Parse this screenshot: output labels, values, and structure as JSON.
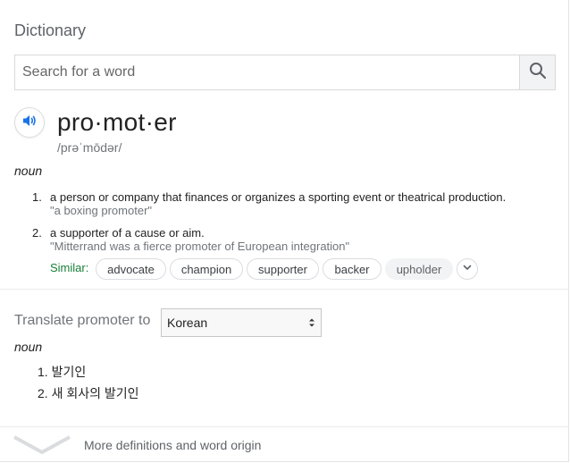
{
  "header": {
    "title": "Dictionary"
  },
  "search": {
    "placeholder": "Search for a word",
    "value": "",
    "icon": "search-icon"
  },
  "entry": {
    "word": "pro·mot·er",
    "phonetic": "/prəˈmōdər/",
    "part_of_speech": "noun",
    "definitions": [
      {
        "num": "1.",
        "text": "a person or company that finances or organizes a sporting event or theatrical production.",
        "example": "\"a boxing promoter\""
      },
      {
        "num": "2.",
        "text": "a supporter of a cause or aim.",
        "example": "\"Mitterrand was a fierce promoter of European integration\""
      }
    ],
    "similar_label": "Similar:",
    "similar": [
      "advocate",
      "champion",
      "supporter",
      "backer",
      "upholder"
    ]
  },
  "translate": {
    "label": "Translate promoter to",
    "language": "Korean",
    "part_of_speech": "noun",
    "items": [
      "1. 발기인",
      "2. 새 회사의 발기인"
    ]
  },
  "footer": {
    "more_label": "More definitions and word origin"
  },
  "colors": {
    "similar_green": "#188038",
    "speaker_blue": "#1a73e8",
    "muted_text": "#70757a"
  }
}
